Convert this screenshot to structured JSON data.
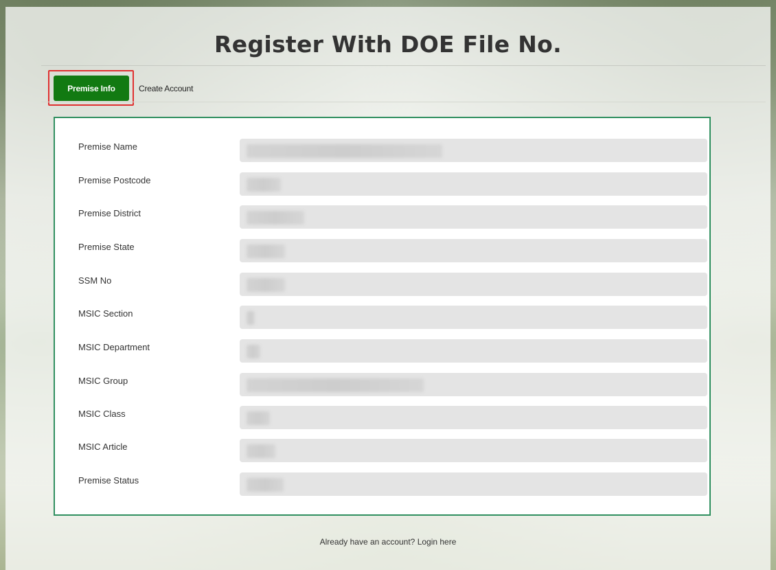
{
  "page": {
    "title": "Register With DOE File No.",
    "footer_text": "Already have an account? Login here"
  },
  "tabs": [
    {
      "label": "Premise Info",
      "active": true
    },
    {
      "label": "Create Account",
      "active": false
    }
  ],
  "colors": {
    "active_tab": "#127a12",
    "tab_highlight": "#e03030",
    "card_border": "#2f8f5f",
    "field_bg": "#e4e4e4"
  },
  "form": {
    "fields": [
      {
        "label": "Premise Name",
        "value": ""
      },
      {
        "label": "Premise Postcode",
        "value": ""
      },
      {
        "label": "Premise District",
        "value": ""
      },
      {
        "label": "Premise State",
        "value": ""
      },
      {
        "label": "SSM No",
        "value": ""
      },
      {
        "label": "MSIC Section",
        "value": ""
      },
      {
        "label": "MSIC Department",
        "value": ""
      },
      {
        "label": "MSIC Group",
        "value": ""
      },
      {
        "label": "MSIC Class",
        "value": ""
      },
      {
        "label": "MSIC Article",
        "value": ""
      },
      {
        "label": "Premise Status",
        "value": ""
      }
    ]
  }
}
